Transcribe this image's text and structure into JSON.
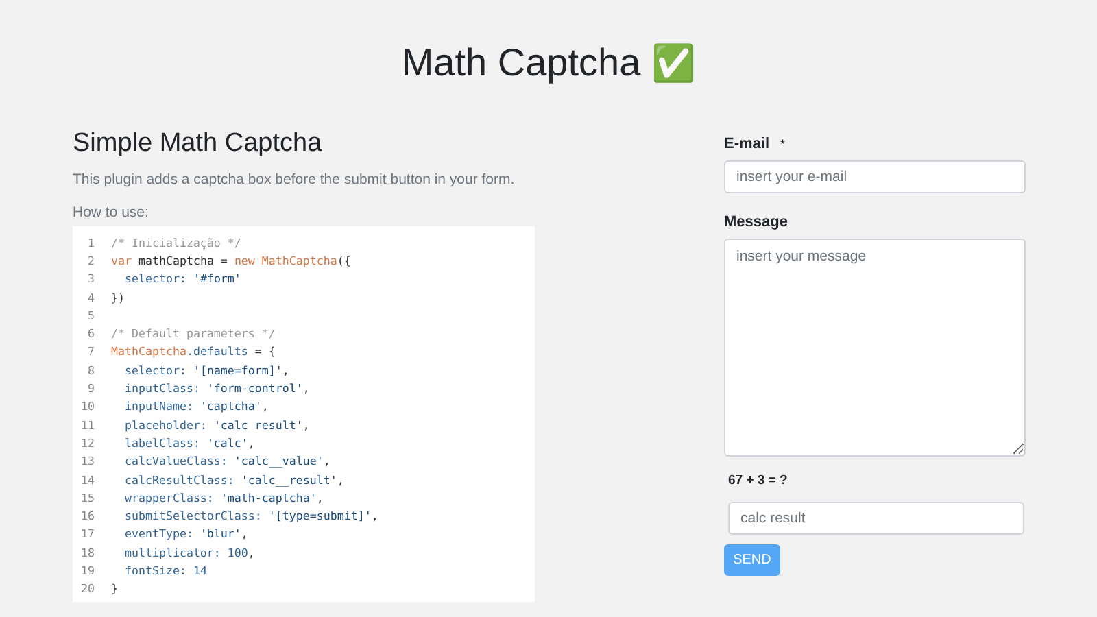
{
  "title": "Math Captcha",
  "title_emoji": "✅",
  "intro": {
    "heading": "Simple Math Captcha",
    "description": "This plugin adds a captcha box before the submit button in your form.",
    "how_to": "How to use:"
  },
  "code": [
    {
      "number": "1",
      "tokens": [
        {
          "kind": "comment",
          "text": "/* Inicialização */"
        }
      ]
    },
    {
      "number": "2",
      "tokens": [
        {
          "kind": "keyword",
          "text": "var"
        },
        {
          "kind": "plain",
          "text": " mathCaptcha = "
        },
        {
          "kind": "keyword",
          "text": "new"
        },
        {
          "kind": "class",
          "text": " MathCaptcha"
        },
        {
          "kind": "plain",
          "text": "({"
        }
      ]
    },
    {
      "number": "3",
      "tokens": [
        {
          "kind": "prop",
          "text": "  selector: "
        },
        {
          "kind": "string",
          "text": "'#form'"
        }
      ]
    },
    {
      "number": "4",
      "tokens": [
        {
          "kind": "plain",
          "text": "})"
        }
      ]
    },
    {
      "number": "5"
    },
    {
      "number": "6",
      "tokens": [
        {
          "kind": "comment",
          "text": "/* Default parameters */"
        }
      ]
    },
    {
      "number": "7",
      "tokens": [
        {
          "kind": "class",
          "text": "MathCaptcha"
        },
        {
          "kind": "prop",
          "text": ".defaults"
        },
        {
          "kind": "plain",
          "text": " = {"
        }
      ]
    },
    {
      "number": "8",
      "tokens": [
        {
          "kind": "prop",
          "text": "  selector: "
        },
        {
          "kind": "string",
          "text": "'[name=form]'"
        },
        {
          "kind": "plain",
          "text": ","
        }
      ]
    },
    {
      "number": "9",
      "tokens": [
        {
          "kind": "prop",
          "text": "  inputClass: "
        },
        {
          "kind": "string",
          "text": "'form-control'"
        },
        {
          "kind": "plain",
          "text": ","
        }
      ]
    },
    {
      "number": "10",
      "tokens": [
        {
          "kind": "prop",
          "text": "  inputName: "
        },
        {
          "kind": "string",
          "text": "'captcha'"
        },
        {
          "kind": "plain",
          "text": ","
        }
      ]
    },
    {
      "number": "11",
      "tokens": [
        {
          "kind": "prop",
          "text": "  placeholder: "
        },
        {
          "kind": "string",
          "text": "'calc result'"
        },
        {
          "kind": "plain",
          "text": ","
        }
      ]
    },
    {
      "number": "12",
      "tokens": [
        {
          "kind": "prop",
          "text": "  labelClass: "
        },
        {
          "kind": "string",
          "text": "'calc'"
        },
        {
          "kind": "plain",
          "text": ","
        }
      ]
    },
    {
      "number": "13",
      "tokens": [
        {
          "kind": "prop",
          "text": "  calcValueClass: "
        },
        {
          "kind": "string",
          "text": "'calc__value'"
        },
        {
          "kind": "plain",
          "text": ","
        }
      ]
    },
    {
      "number": "14",
      "tokens": [
        {
          "kind": "prop",
          "text": "  calcResultClass: "
        },
        {
          "kind": "string",
          "text": "'calc__result'"
        },
        {
          "kind": "plain",
          "text": ","
        }
      ]
    },
    {
      "number": "15",
      "tokens": [
        {
          "kind": "prop",
          "text": "  wrapperClass: "
        },
        {
          "kind": "string",
          "text": "'math-captcha'"
        },
        {
          "kind": "plain",
          "text": ","
        }
      ]
    },
    {
      "number": "16",
      "tokens": [
        {
          "kind": "prop",
          "text": "  submitSelectorClass: "
        },
        {
          "kind": "string",
          "text": "'[type=submit]'"
        },
        {
          "kind": "plain",
          "text": ","
        }
      ]
    },
    {
      "number": "17",
      "tokens": [
        {
          "kind": "prop",
          "text": "  eventType: "
        },
        {
          "kind": "string",
          "text": "'blur'"
        },
        {
          "kind": "plain",
          "text": ","
        }
      ]
    },
    {
      "number": "18",
      "tokens": [
        {
          "kind": "prop",
          "text": "  multiplicator: "
        },
        {
          "kind": "number",
          "text": "100"
        },
        {
          "kind": "plain",
          "text": ","
        }
      ]
    },
    {
      "number": "19",
      "tokens": [
        {
          "kind": "prop",
          "text": "  fontSize: "
        },
        {
          "kind": "number",
          "text": "14"
        }
      ]
    },
    {
      "number": "20",
      "tokens": [
        {
          "kind": "plain",
          "text": "}"
        }
      ]
    }
  ],
  "form": {
    "email_label": "E-mail",
    "required_mark": "*",
    "email_placeholder": "insert your e-mail",
    "message_label": "Message",
    "message_placeholder": "insert your message",
    "captcha_question": "67 + 3 = ?",
    "captcha_placeholder": "calc result",
    "submit": "SEND"
  }
}
